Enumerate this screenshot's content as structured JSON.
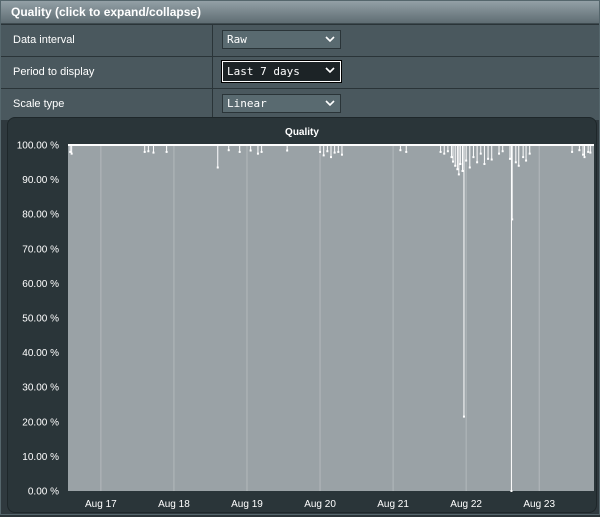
{
  "header": {
    "title": "Quality (click to expand/collapse)"
  },
  "controls": [
    {
      "label": "Data interval",
      "value": "Raw",
      "focused": false
    },
    {
      "label": "Period to display",
      "value": "Last 7 days",
      "focused": true
    },
    {
      "label": "Scale type",
      "value": "Linear",
      "focused": false
    }
  ],
  "colors": {
    "plot_bg": "#9aa2a6",
    "series": "#ffffff",
    "grid": "#b3b9bc"
  },
  "chart_data": {
    "type": "line",
    "title": "Quality",
    "ylim": [
      0,
      100
    ],
    "yticks": [
      0,
      10,
      20,
      30,
      40,
      50,
      60,
      70,
      80,
      90,
      100
    ],
    "ytick_labels": [
      "0.00 %",
      "10.00 %",
      "20.00 %",
      "30.00 %",
      "40.00 %",
      "50.00 %",
      "60.00 %",
      "70.00 %",
      "80.00 %",
      "90.00 %",
      "100.00 %"
    ],
    "xlim": [
      16.55,
      23.75
    ],
    "xticks": [
      17,
      18,
      19,
      20,
      21,
      22,
      23
    ],
    "xtick_labels": [
      "Aug 17",
      "Aug 18",
      "Aug 19",
      "Aug 20",
      "Aug 21",
      "Aug 22",
      "Aug 23"
    ],
    "grid": true,
    "series": [
      {
        "baseline": 100,
        "dips": [
          [
            16.58,
            98
          ],
          [
            16.6,
            97.5
          ],
          [
            17.6,
            98
          ],
          [
            17.65,
            98.2
          ],
          [
            17.72,
            97.8
          ],
          [
            17.9,
            98
          ],
          [
            18.6,
            93.5
          ],
          [
            18.75,
            98.5
          ],
          [
            18.9,
            98
          ],
          [
            19.05,
            98.4
          ],
          [
            19.15,
            97.5
          ],
          [
            19.2,
            98
          ],
          [
            19.55,
            98.4
          ],
          [
            20.0,
            98
          ],
          [
            20.05,
            97
          ],
          [
            20.1,
            98.2
          ],
          [
            20.15,
            96.5
          ],
          [
            20.2,
            97.8
          ],
          [
            20.25,
            98
          ],
          [
            20.3,
            97.2
          ],
          [
            21.1,
            98.5
          ],
          [
            21.18,
            98
          ],
          [
            21.65,
            98
          ],
          [
            21.7,
            97.5
          ],
          [
            21.75,
            98.2
          ],
          [
            21.8,
            96.5
          ],
          [
            21.82,
            95.2
          ],
          [
            21.85,
            94
          ],
          [
            21.88,
            93
          ],
          [
            21.9,
            91.5
          ],
          [
            21.92,
            94.5
          ],
          [
            21.95,
            92.5
          ],
          [
            21.97,
            21.5
          ],
          [
            22.0,
            95.5
          ],
          [
            22.05,
            93.5
          ],
          [
            22.1,
            96.5
          ],
          [
            22.15,
            95
          ],
          [
            22.2,
            97.5
          ],
          [
            22.25,
            94.5
          ],
          [
            22.3,
            96
          ],
          [
            22.35,
            95.8
          ],
          [
            22.45,
            97.5
          ],
          [
            22.5,
            98.2
          ],
          [
            22.6,
            96
          ],
          [
            22.62,
            0
          ],
          [
            22.63,
            78.5
          ],
          [
            22.68,
            95
          ],
          [
            22.72,
            94
          ],
          [
            22.78,
            96.5
          ],
          [
            22.82,
            95.5
          ],
          [
            22.87,
            97.5
          ],
          [
            23.45,
            98
          ],
          [
            23.55,
            98.5
          ],
          [
            23.6,
            97.2
          ],
          [
            23.62,
            96.5
          ],
          [
            23.67,
            98
          ],
          [
            23.7,
            97.8
          ]
        ]
      }
    ]
  }
}
